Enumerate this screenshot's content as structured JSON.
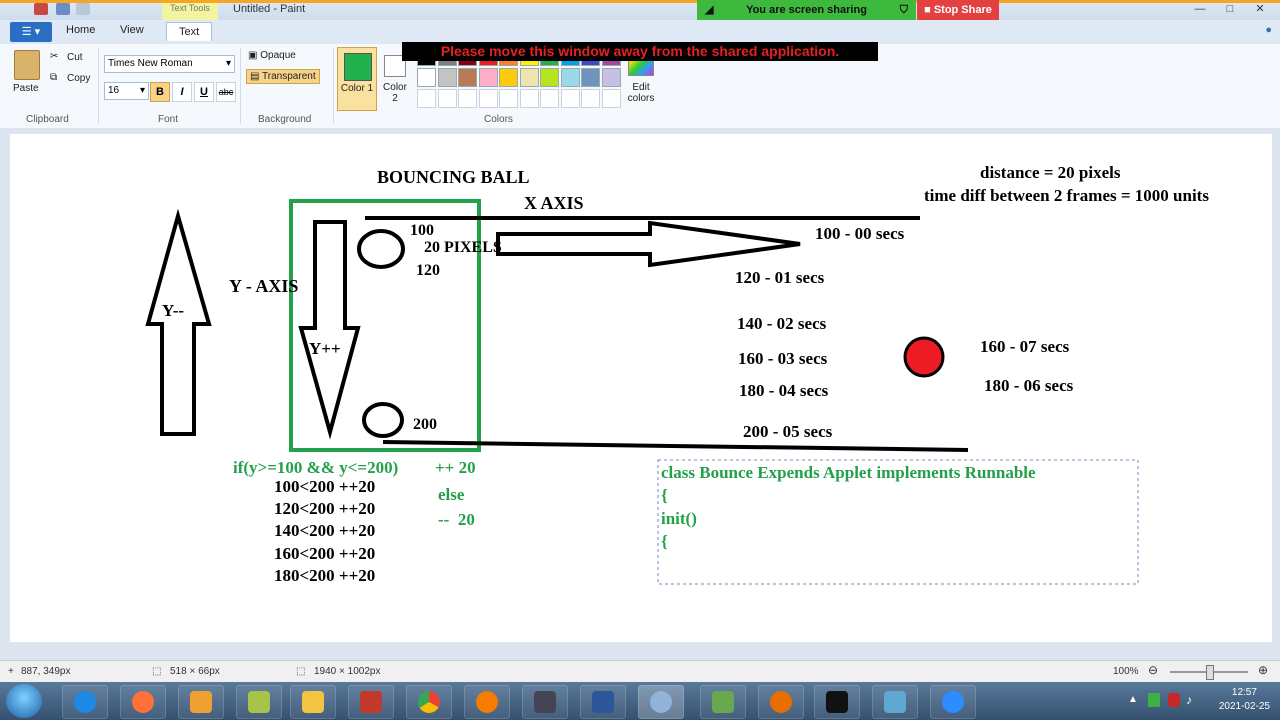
{
  "titlebar": {
    "title": "Untitled - Paint",
    "context_tab": "Text Tools"
  },
  "share": {
    "banner": "You are screen sharing",
    "stop_label": "Stop Share",
    "warning": "Please move this window away from the shared application."
  },
  "tabs": {
    "home": "Home",
    "view": "View",
    "text": "Text"
  },
  "ribbon": {
    "paste": "Paste",
    "cut": "Cut",
    "copy": "Copy",
    "font_name": "Times New Roman",
    "font_size": "16",
    "bold": "B",
    "italic": "I",
    "underline": "U",
    "strike": "abc",
    "opaque": "Opaque",
    "transparent": "Transparent",
    "color1": "Color 1",
    "color2": "Color 2",
    "edit_colors": "Edit colors",
    "groups": {
      "clipboard": "Clipboard",
      "font": "Font",
      "background": "Background",
      "colors": "Colors"
    }
  },
  "colors": {
    "palette_row1": [
      "#ffffff",
      "#c3c3c3",
      "#b97a57",
      "#ffaec9",
      "#ffc90e",
      "#efe4b0",
      "#b5e61d",
      "#99d9ea",
      "#7092be",
      "#c8bfe7"
    ],
    "palette_row0": [
      "#000000",
      "#7f7f7f",
      "#880015",
      "#ed1c24",
      "#ff7f27",
      "#fff200",
      "#22b14c",
      "#00a2e8",
      "#3f48cc",
      "#a349a4"
    ],
    "color1": "#22b14c",
    "color2": "#ffffff"
  },
  "drawing": {
    "title": "BOUNCING BALL",
    "x_axis": "X AXIS",
    "y_axis": "Y - AXIS",
    "y_minus": "Y--",
    "y_plus": "Y++",
    "distance": "distance = 20 pixels",
    "time_diff": "time diff between 2 frames = 1000 units",
    "label_100": "100",
    "label_20px": "20 PIXELS",
    "label_120": "120",
    "label_200": "200",
    "times": [
      "100 - 00 secs",
      "120 - 01 secs",
      "140 - 02 secs",
      "160 - 03 secs",
      "180 - 04 secs",
      "200 - 05 secs"
    ],
    "times_right": [
      "160 - 07 secs",
      "180 - 06 secs"
    ],
    "condition": "if(y>=100 && y<=200)",
    "plus20": "++ 20",
    "else": "else",
    "minus20": "--  20",
    "checks": [
      "100<200 ++20",
      "120<200 ++20",
      "140<200 ++20",
      "160<200 ++20",
      "180<200 ++20"
    ],
    "code": [
      "class Bounce Expends Applet implements Runnable",
      "{",
      "init()",
      "{"
    ]
  },
  "status": {
    "cursor": "887, 349px",
    "selection": "518 × 66px",
    "image_size": "1940 × 1002px",
    "zoom": "100%"
  },
  "clock": {
    "time": "12:57",
    "date": "2021-02-25"
  }
}
